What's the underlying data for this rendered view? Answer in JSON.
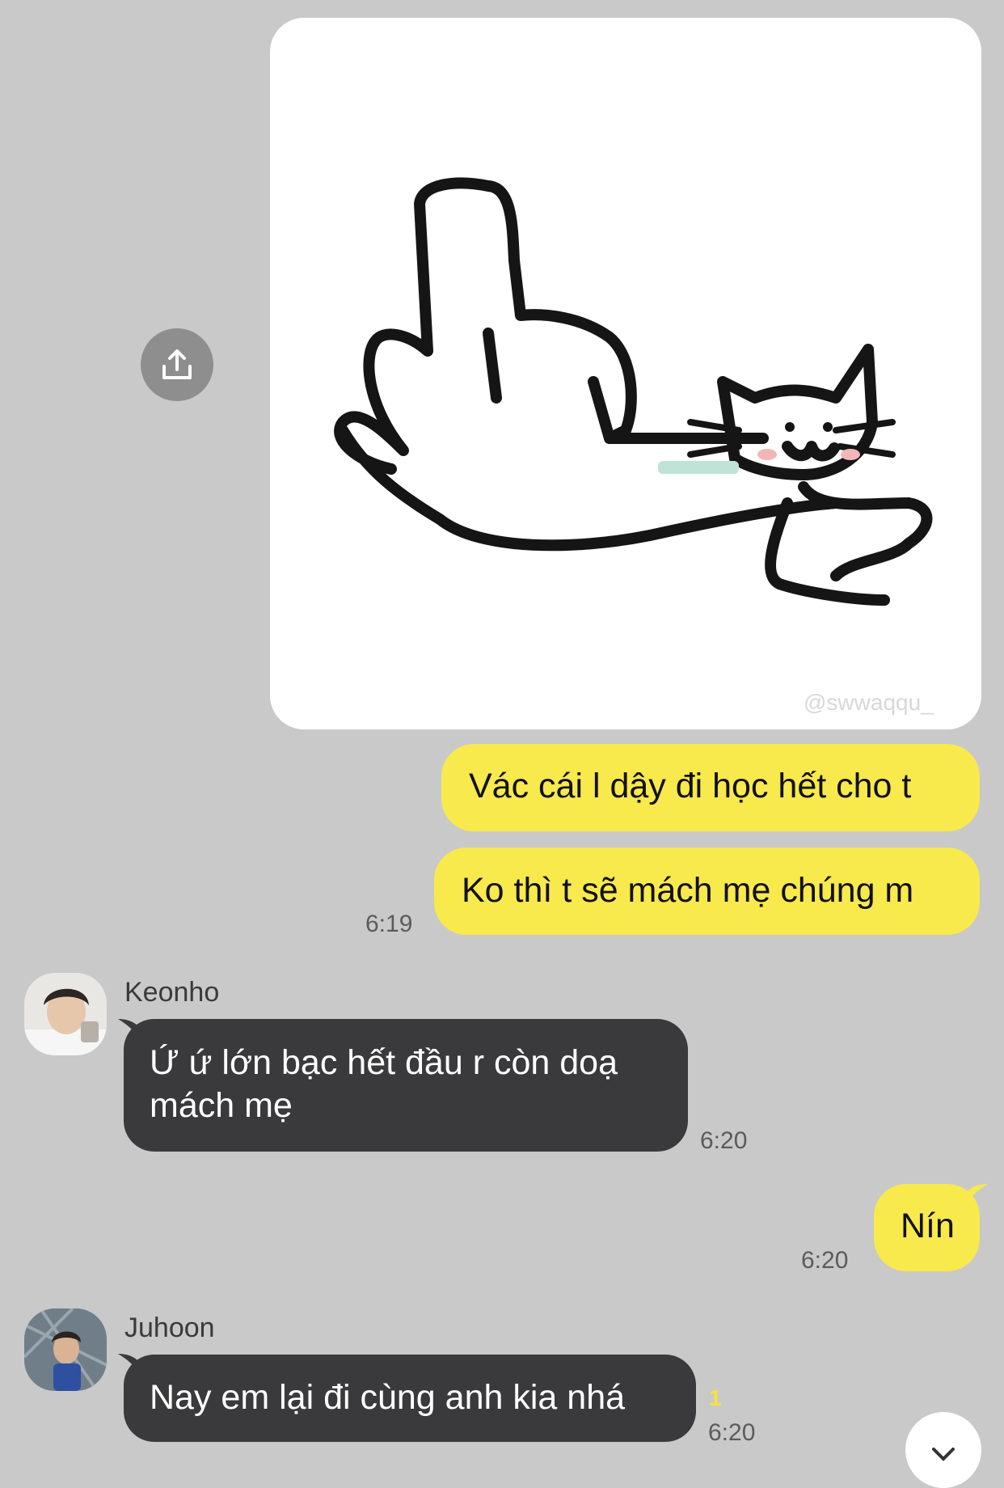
{
  "messages": {
    "image_watermark": "@swwaqqu_",
    "sent_1": "Vác cái l dậy đi học hết cho t",
    "sent_2": "Ko thì t sẽ mách mẹ chúng m",
    "sent_2_time": "6:19",
    "keonho": {
      "name": "Keonho",
      "text": "Ứ ứ lớn bạc hết đầu r còn doạ mách mẹ",
      "time": "6:20"
    },
    "sent_3": "Nín",
    "sent_3_time": "6:20",
    "juhoon": {
      "name": "Juhoon",
      "text": "Nay em lại đi cùng anh kia nhá",
      "unread": "1",
      "time": "6:20"
    }
  },
  "icons": {
    "share": "share-icon",
    "scroll": "chevron-down-icon"
  },
  "colors": {
    "background": "#c9c9c9",
    "my_bubble": "#f8e94d",
    "their_bubble": "#3a3a3c",
    "unread": "#f7e33d"
  }
}
